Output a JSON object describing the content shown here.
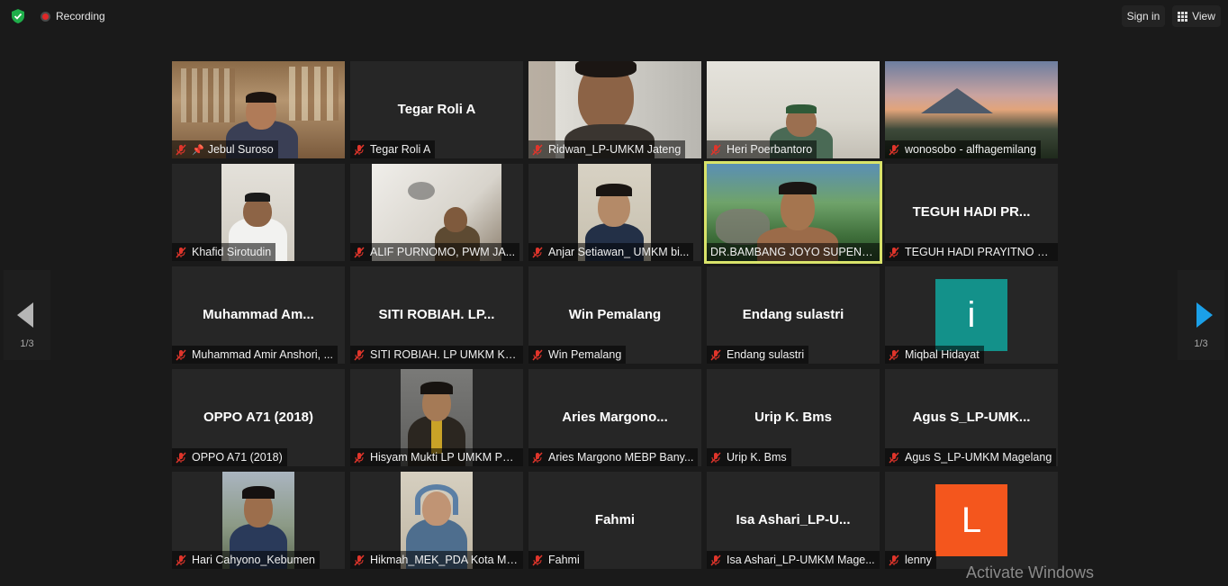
{
  "topbar": {
    "recording_label": "Recording",
    "signin_label": "Sign in",
    "view_label": "View"
  },
  "navigation": {
    "left_page": "1/3",
    "right_page": "1/3"
  },
  "tiles": [
    {
      "label": "Jebul Suroso",
      "big": ""
    },
    {
      "label": "Tegar Roli A",
      "big": "Tegar Roli A"
    },
    {
      "label": "Ridwan_LP-UMKM Jateng",
      "big": ""
    },
    {
      "label": "Heri Poerbantoro",
      "big": ""
    },
    {
      "label": "wonosobo - alfhagemilang",
      "big": ""
    },
    {
      "label": "Khafid Sirotudin",
      "big": ""
    },
    {
      "label": "ALIF PURNOMO, PWM JA...",
      "big": ""
    },
    {
      "label": "Anjar Setiawan_ UMKM bi...",
      "big": ""
    },
    {
      "label": "DR.BAMBANG JOYO SUPENO,...",
      "big": ""
    },
    {
      "label": "TEGUH HADI PRAYITNO se...",
      "big": "TEGUH HADI PR..."
    },
    {
      "label": "Muhammad Amir Anshori, ...",
      "big": "Muhammad  Am..."
    },
    {
      "label": "SITI ROBIAH. LP UMKM KA...",
      "big": "SITI  ROBIAH.  LP..."
    },
    {
      "label": "Win Pemalang",
      "big": "Win Pemalang"
    },
    {
      "label": "Endang sulastri",
      "big": "Endang sulastri"
    },
    {
      "label": "Miqbal Hidayat",
      "big": ""
    },
    {
      "label": "OPPO A71 (2018)",
      "big": "OPPO A71 (2018)"
    },
    {
      "label": "Hisyam Mukti LP UMKM PE...",
      "big": ""
    },
    {
      "label": "Aries Margono MEBP Bany...",
      "big": "Aries  Margono..."
    },
    {
      "label": "Urip K. Bms",
      "big": "Urip K. Bms"
    },
    {
      "label": "Agus S_LP-UMKM Magelang",
      "big": "Agus  S_LP-UMK..."
    },
    {
      "label": "Hari Cahyono_Kebumen",
      "big": ""
    },
    {
      "label": "Hikmah_MEK_PDA Kota Ma...",
      "big": ""
    },
    {
      "label": "Fahmi",
      "big": "Fahmi"
    },
    {
      "label": "Isa Ashari_LP-UMKM Mage...",
      "big": "Isa  Ashari_LP-U..."
    },
    {
      "label": "lenny",
      "big": ""
    }
  ],
  "avatars": {
    "miqbal": {
      "letter": "i",
      "color": "#13918a"
    },
    "lenny": {
      "letter": "L",
      "color": "#f4561d"
    }
  },
  "watermark": "Activate Windows",
  "colors": {
    "background": "#1a1a1a",
    "active_speaker_border": "#d9e36a",
    "next_arrow": "#1ba0e8",
    "muted_mic": "#e0352b"
  }
}
